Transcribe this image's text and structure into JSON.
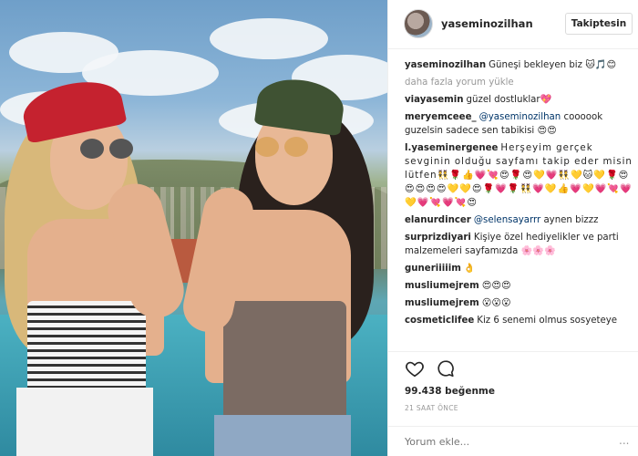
{
  "header": {
    "username": "yaseminozilhan",
    "follow_label": "Takiptesin"
  },
  "caption": {
    "user": "yaseminozilhan",
    "text": "Güneşi bekleyen biz 🐱🎵😊"
  },
  "load_more": "daha fazla yorum yükle",
  "comments": [
    {
      "user": "viayasemin",
      "mention": "",
      "text": "güzel dostluklar💖"
    },
    {
      "user": "meryemceee_",
      "mention": "@yaseminozilhan",
      "text": "coooook guzelsin sadece sen tabikisi 😍😍"
    },
    {
      "user": "l.yaseminergenee",
      "mention": "",
      "text": "Herşeyim gerçek sevginin olduğu sayfamı takip eder misin lütfen👯🌹👍💗💘😍🌹😍💛💗👯💛🐱💛🌹😍😍😍😍😍💛💛😍🌹💗🌹👯💗💛👍💗💛💗💘💗💛💗💘💗💘😍"
    },
    {
      "user": "elanurdincer",
      "mention": "@selensayarrr",
      "text": "aynen bizzz"
    },
    {
      "user": "surprizdiyari",
      "mention": "",
      "text": "Kişiye özel hediyelikler ve parti malzemeleri sayfamızda 🌸🌸🌸"
    },
    {
      "user": "guneriiiiim",
      "mention": "",
      "text": "👌"
    },
    {
      "user": "musliumejrem",
      "mention": "",
      "text": "😍😍😍"
    },
    {
      "user": "musliumejrem",
      "mention": "",
      "text": "😮😮😮"
    },
    {
      "user": "cosmeticlifee",
      "mention": "",
      "text": "Kiz 6 senemi olmus sosyeteye"
    }
  ],
  "likes": "99.438 beğenme",
  "time": "21 SAAT ÖNCE",
  "comment_input": {
    "placeholder": "Yorum ekle..."
  },
  "more_options": "...",
  "colors": {
    "link": "#003569",
    "muted": "#999999",
    "border": "#efefef"
  }
}
